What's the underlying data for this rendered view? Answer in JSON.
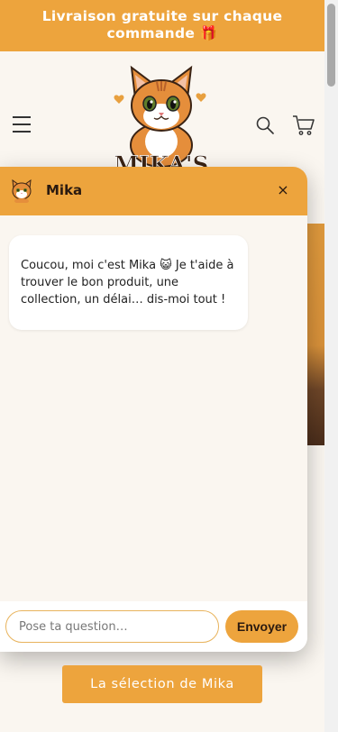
{
  "announcement": {
    "text": "Livraison gratuite sur chaque commande 🎁"
  },
  "header": {
    "menu_icon": "hamburger-menu-icon",
    "search_icon": "search-icon",
    "cart_icon": "cart-icon",
    "logo_text": "MIKA'S"
  },
  "chat": {
    "title": "Mika",
    "close_label": "×",
    "message": "Coucou, moi c'est Mika 😺 Je t'aide à trouver le bon produit, une collection, un délai… dis-moi tout !",
    "input_placeholder": "Pose ta question…",
    "send_label": "Envoyer"
  },
  "cta": {
    "label": "La sélection de Mika"
  },
  "colors": {
    "accent": "#eda43d",
    "background": "#faf6f0",
    "dark": "#2a1a10"
  }
}
